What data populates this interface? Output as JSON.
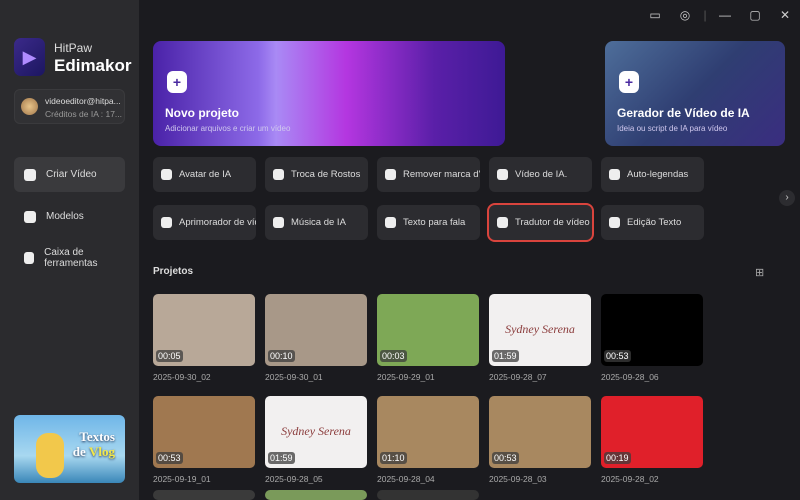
{
  "app": {
    "brand_top": "HitPaw",
    "brand_name": "Edimakor"
  },
  "account": {
    "email": "videoeditor@hitpa...",
    "credits": "Créditos de IA : 17..."
  },
  "sidebar": {
    "items": [
      {
        "label": "Criar Vídeo",
        "icon": "create-video-icon",
        "active": true
      },
      {
        "label": "Modelos",
        "icon": "templates-icon"
      },
      {
        "label": "Caixa de ferramentas",
        "icon": "toolbox-icon"
      }
    ]
  },
  "promo": {
    "line1": "Textos",
    "line2a": "de ",
    "line2b": "Vlog"
  },
  "window": {
    "icons": [
      "feedback-icon",
      "location-icon",
      "minimize-icon",
      "maximize-icon",
      "close-icon"
    ]
  },
  "cards": [
    {
      "title": "Novo projeto",
      "subtitle": "Adicionar arquivos e criar um vídeo"
    },
    {
      "title": "Gerador de Vídeo de IA",
      "subtitle": "Ideia ou script de IA para vídeo"
    }
  ],
  "tools": [
    {
      "label": "Avatar de IA"
    },
    {
      "label": "Troca de Rostos"
    },
    {
      "label": "Remover marca d'água"
    },
    {
      "label": "Vídeo de IA."
    },
    {
      "label": "Auto-legendas"
    },
    {
      "label": "Aprimorador de vídeo"
    },
    {
      "label": "Música de IA"
    },
    {
      "label": "Texto para fala"
    },
    {
      "label": "Tradutor de vídeo",
      "selected": true
    },
    {
      "label": "Edição Texto"
    }
  ],
  "projects": {
    "title": "Projetos",
    "items": [
      {
        "name": "2025-09-30_02",
        "duration": "00:05",
        "bg": "#b8a898"
      },
      {
        "name": "2025-09-30_01",
        "duration": "00:10",
        "bg": "#a89888"
      },
      {
        "name": "2025-09-29_01",
        "duration": "00:03",
        "bg": "#7ea856"
      },
      {
        "name": "2025-09-28_07",
        "duration": "01:59",
        "bg": "#f2f0f0",
        "sig": "Sydney Serena"
      },
      {
        "name": "2025-09-28_06",
        "duration": "00:53",
        "bg": "#000000"
      },
      {
        "name": "2025-09-19_01",
        "duration": "00:53",
        "bg": "#a07850"
      },
      {
        "name": "2025-09-28_05",
        "duration": "01:59",
        "bg": "#f2f0f0",
        "sig": "Sydney Serena"
      },
      {
        "name": "2025-09-28_04",
        "duration": "01:10",
        "bg": "#a88860"
      },
      {
        "name": "2025-09-28_03",
        "duration": "00:53",
        "bg": "#a88860"
      },
      {
        "name": "2025-09-28_02",
        "duration": "00:19",
        "bg": "#e0202a"
      }
    ]
  }
}
